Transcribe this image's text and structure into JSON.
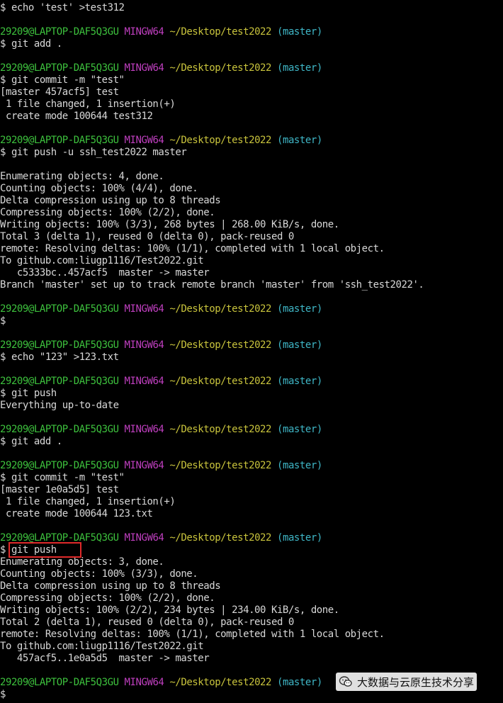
{
  "prompt": {
    "user": "29209@LAPTOP-DAF5Q3GU",
    "env": "MINGW64",
    "path": "~/Desktop/test2022",
    "branch": "(master)"
  },
  "lines": [
    {
      "type": "out",
      "text": "$ echo 'test' >test312"
    },
    {
      "type": "blank"
    },
    {
      "type": "prompt"
    },
    {
      "type": "out",
      "text": "$ git add ."
    },
    {
      "type": "blank"
    },
    {
      "type": "prompt"
    },
    {
      "type": "out",
      "text": "$ git commit -m \"test\""
    },
    {
      "type": "out",
      "text": "[master 457acf5] test"
    },
    {
      "type": "out",
      "text": " 1 file changed, 1 insertion(+)"
    },
    {
      "type": "out",
      "text": " create mode 100644 test312"
    },
    {
      "type": "blank"
    },
    {
      "type": "prompt"
    },
    {
      "type": "out",
      "text": "$ git push -u ssh_test2022 master"
    },
    {
      "type": "blank"
    },
    {
      "type": "out",
      "text": "Enumerating objects: 4, done."
    },
    {
      "type": "out",
      "text": "Counting objects: 100% (4/4), done."
    },
    {
      "type": "out",
      "text": "Delta compression using up to 8 threads"
    },
    {
      "type": "out",
      "text": "Compressing objects: 100% (2/2), done."
    },
    {
      "type": "out",
      "text": "Writing objects: 100% (3/3), 268 bytes | 268.00 KiB/s, done."
    },
    {
      "type": "out",
      "text": "Total 3 (delta 1), reused 0 (delta 0), pack-reused 0"
    },
    {
      "type": "out",
      "text": "remote: Resolving deltas: 100% (1/1), completed with 1 local object."
    },
    {
      "type": "out",
      "text": "To github.com:liugp1116/Test2022.git"
    },
    {
      "type": "out",
      "text": "   c5333bc..457acf5  master -> master"
    },
    {
      "type": "out",
      "text": "Branch 'master' set up to track remote branch 'master' from 'ssh_test2022'."
    },
    {
      "type": "blank"
    },
    {
      "type": "prompt"
    },
    {
      "type": "out",
      "text": "$"
    },
    {
      "type": "blank"
    },
    {
      "type": "prompt"
    },
    {
      "type": "out",
      "text": "$ echo \"123\" >123.txt"
    },
    {
      "type": "blank"
    },
    {
      "type": "prompt"
    },
    {
      "type": "out",
      "text": "$ git push"
    },
    {
      "type": "out",
      "text": "Everything up-to-date"
    },
    {
      "type": "blank"
    },
    {
      "type": "prompt"
    },
    {
      "type": "out",
      "text": "$ git add ."
    },
    {
      "type": "blank"
    },
    {
      "type": "prompt"
    },
    {
      "type": "out",
      "text": "$ git commit -m \"test\""
    },
    {
      "type": "out",
      "text": "[master 1e0a5d5] test"
    },
    {
      "type": "out",
      "text": " 1 file changed, 1 insertion(+)"
    },
    {
      "type": "out",
      "text": " create mode 100644 123.txt"
    },
    {
      "type": "blank"
    },
    {
      "type": "prompt"
    },
    {
      "type": "out",
      "text": "$ git push"
    },
    {
      "type": "out",
      "text": "Enumerating objects: 3, done."
    },
    {
      "type": "out",
      "text": "Counting objects: 100% (3/3), done."
    },
    {
      "type": "out",
      "text": "Delta compression using up to 8 threads"
    },
    {
      "type": "out",
      "text": "Compressing objects: 100% (2/2), done."
    },
    {
      "type": "out",
      "text": "Writing objects: 100% (2/2), 234 bytes | 234.00 KiB/s, done."
    },
    {
      "type": "out",
      "text": "Total 2 (delta 1), reused 0 (delta 0), pack-reused 0"
    },
    {
      "type": "out",
      "text": "remote: Resolving deltas: 100% (1/1), completed with 1 local object."
    },
    {
      "type": "out",
      "text": "To github.com:liugp1116/Test2022.git"
    },
    {
      "type": "out",
      "text": "   457acf5..1e0a5d5  master -> master"
    },
    {
      "type": "blank"
    },
    {
      "type": "prompt"
    },
    {
      "type": "out",
      "text": "$"
    }
  ],
  "watermark": {
    "text": "大数据与云原生技术分享",
    "icon": "wechat-icon"
  },
  "colors": {
    "background": "#000000",
    "text": "#d8d8d8",
    "user": "#3dc13d",
    "env": "#bf3fbf",
    "path": "#c8c33c",
    "branch": "#3fb7c7",
    "highlight": "#e02a2a"
  }
}
